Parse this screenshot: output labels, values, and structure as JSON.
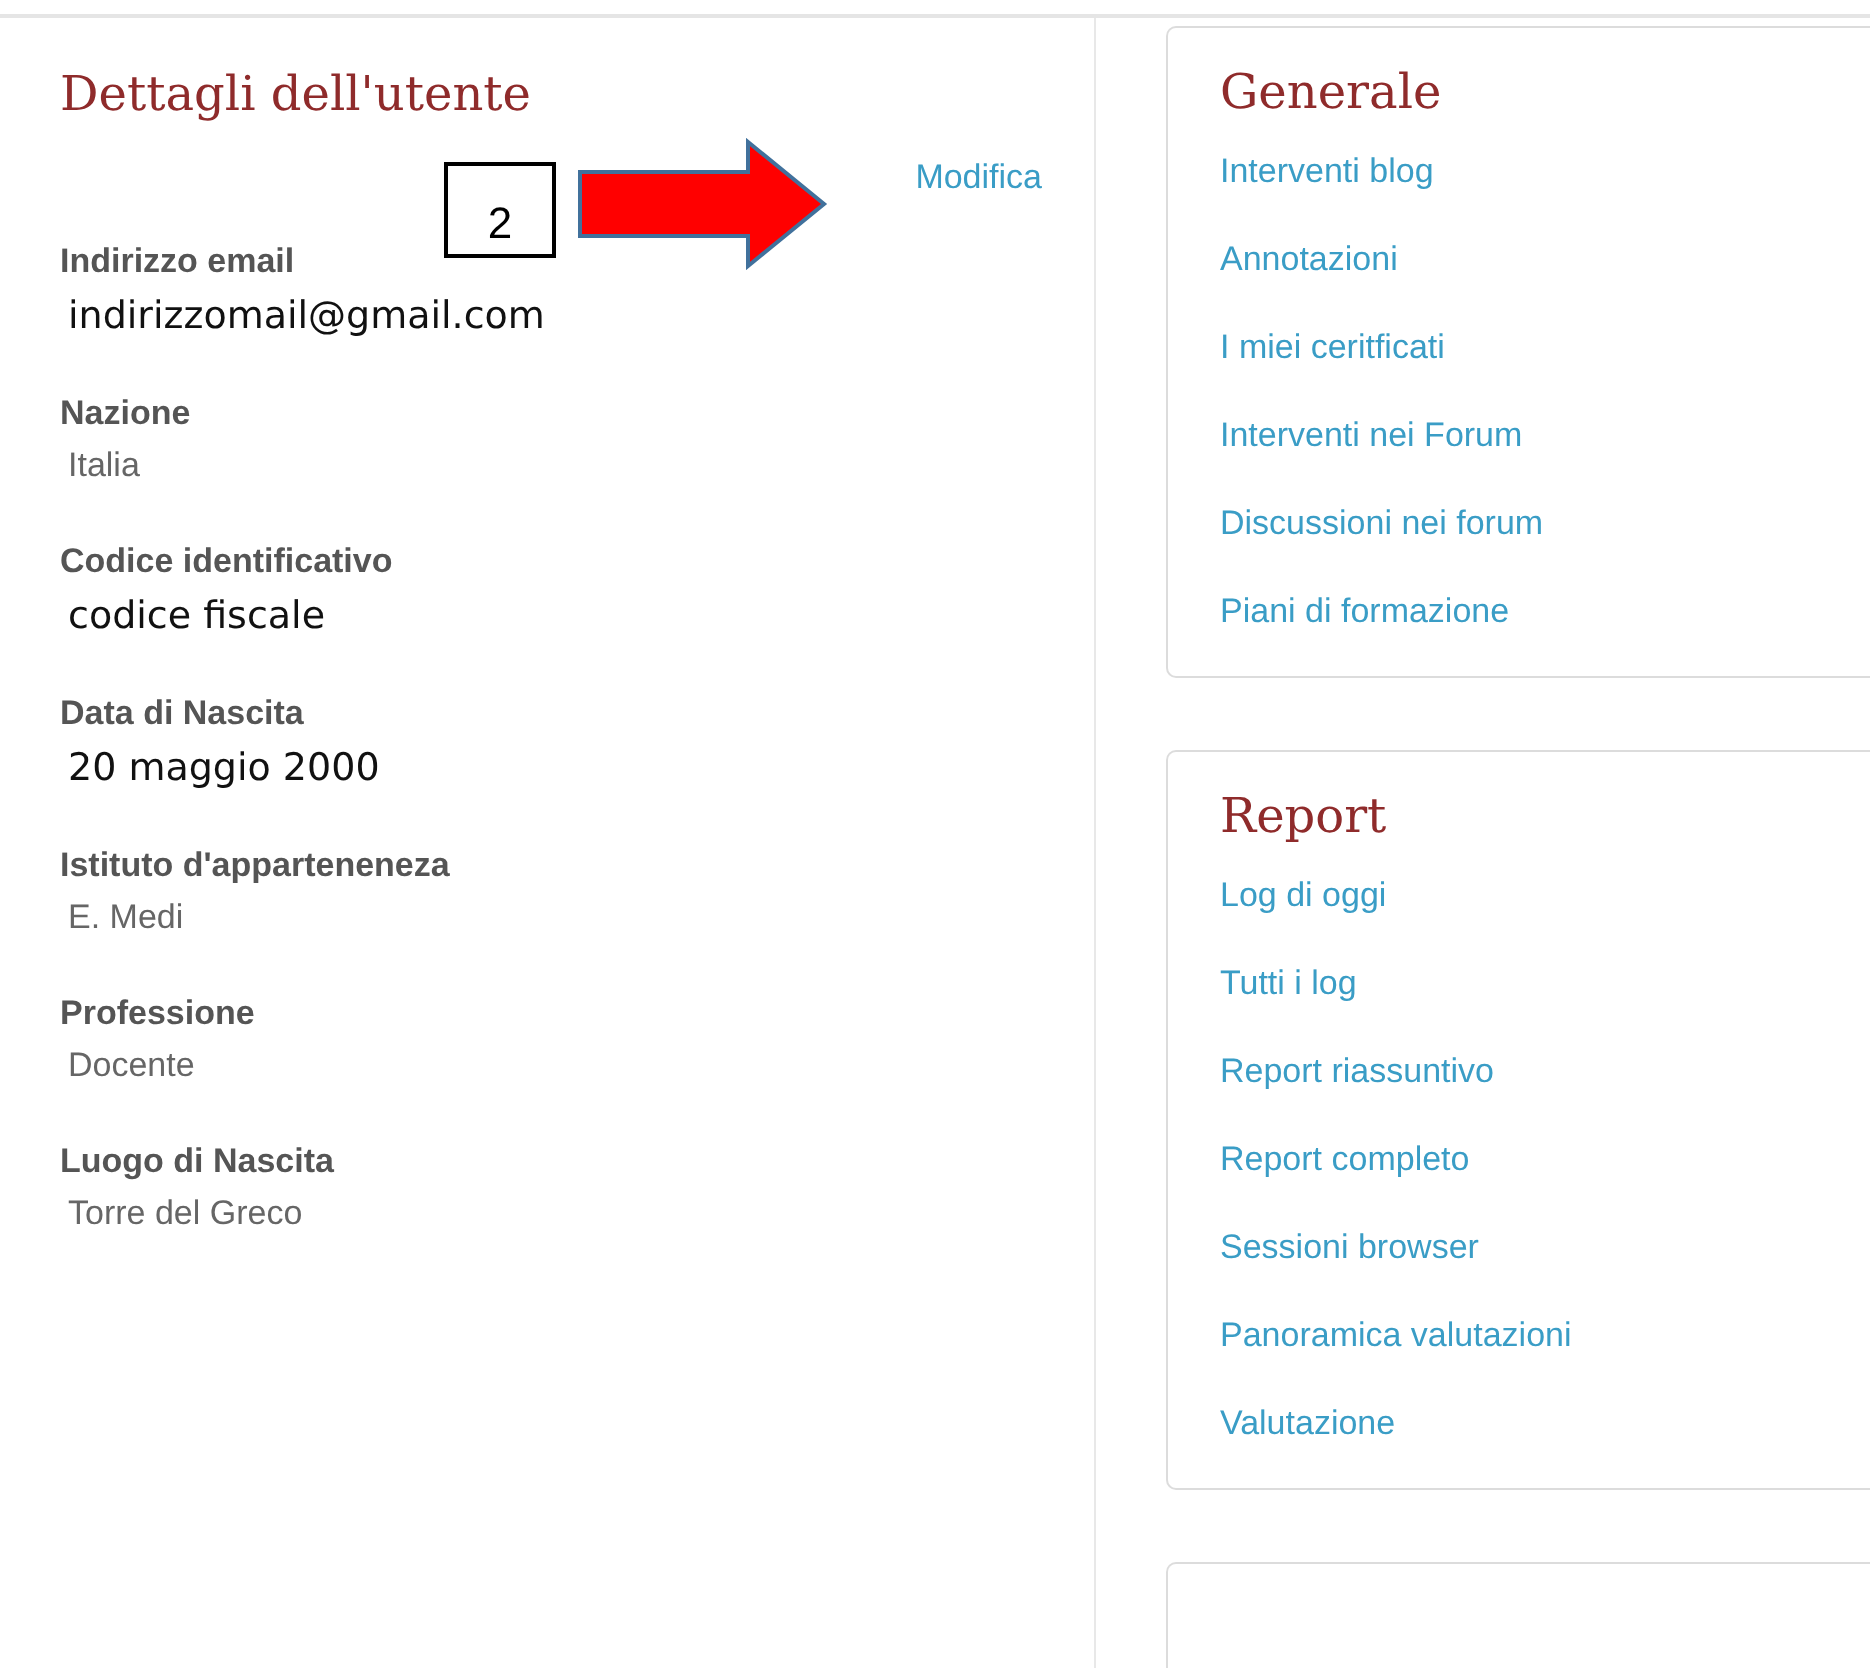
{
  "profile": {
    "title": "Dettagli dell'utente",
    "edit_link": "Modifica",
    "annotation": {
      "step": "2"
    },
    "fields": [
      {
        "label": "Indirizzo email",
        "value": "indirizzomail@gmail.com",
        "kind": "typed"
      },
      {
        "label": "Nazione",
        "value": "Italia",
        "kind": "plain"
      },
      {
        "label": "Codice identificativo",
        "value": "codice fiscale",
        "kind": "typed"
      },
      {
        "label": "Data di Nascita",
        "value": "20 maggio 2000",
        "kind": "typed"
      },
      {
        "label": "Istituto d'apparteneneza",
        "value": "E. Medi",
        "kind": "plain"
      },
      {
        "label": "Professione",
        "value": "Docente",
        "kind": "plain"
      },
      {
        "label": "Luogo di Nascita",
        "value": "Torre del Greco",
        "kind": "plain"
      }
    ]
  },
  "cards": [
    {
      "title": "Generale",
      "links": [
        "Interventi blog",
        "Annotazioni",
        "I miei ceritficati",
        "Interventi nei Forum",
        "Discussioni nei forum",
        "Piani di formazione"
      ]
    },
    {
      "title": "Report",
      "links": [
        "Log di oggi",
        "Tutti i log",
        "Report riassuntivo",
        "Report completo",
        "Sessioni browser",
        "Panoramica valutazioni",
        "Valutazione"
      ]
    }
  ]
}
